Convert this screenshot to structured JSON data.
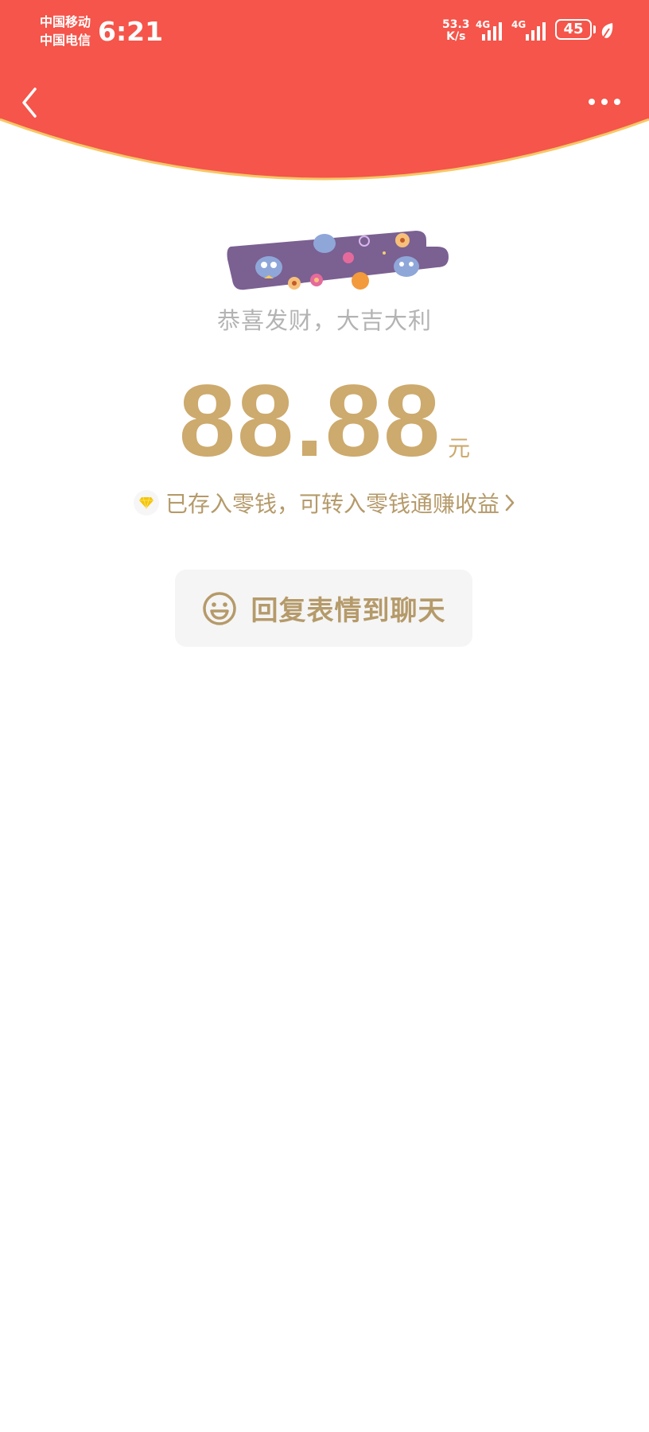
{
  "status_bar": {
    "carrier_1": "中国移动",
    "carrier_2": "中国电信",
    "time": "6:21",
    "net_speed_value": "53.3",
    "net_speed_unit": "K/s",
    "signal_1_label": "4G",
    "signal_2_label": "4G",
    "battery_level": "45"
  },
  "header": {
    "back_icon": "chevron-left-icon",
    "more_icon": "more-dots-icon",
    "bg_color": "#f5554a",
    "rim_color": "#f6c766"
  },
  "envelope": {
    "greeting": "恭喜发财，大吉大利",
    "amount": "88.88",
    "unit": "元",
    "notice": "已存入零钱，可转入零钱通赚收益",
    "notice_icon": "diamond-icon",
    "amount_color": "#cdaa6d"
  },
  "reply_button": {
    "icon": "smiley-icon",
    "label": "回复表情到聊天"
  }
}
